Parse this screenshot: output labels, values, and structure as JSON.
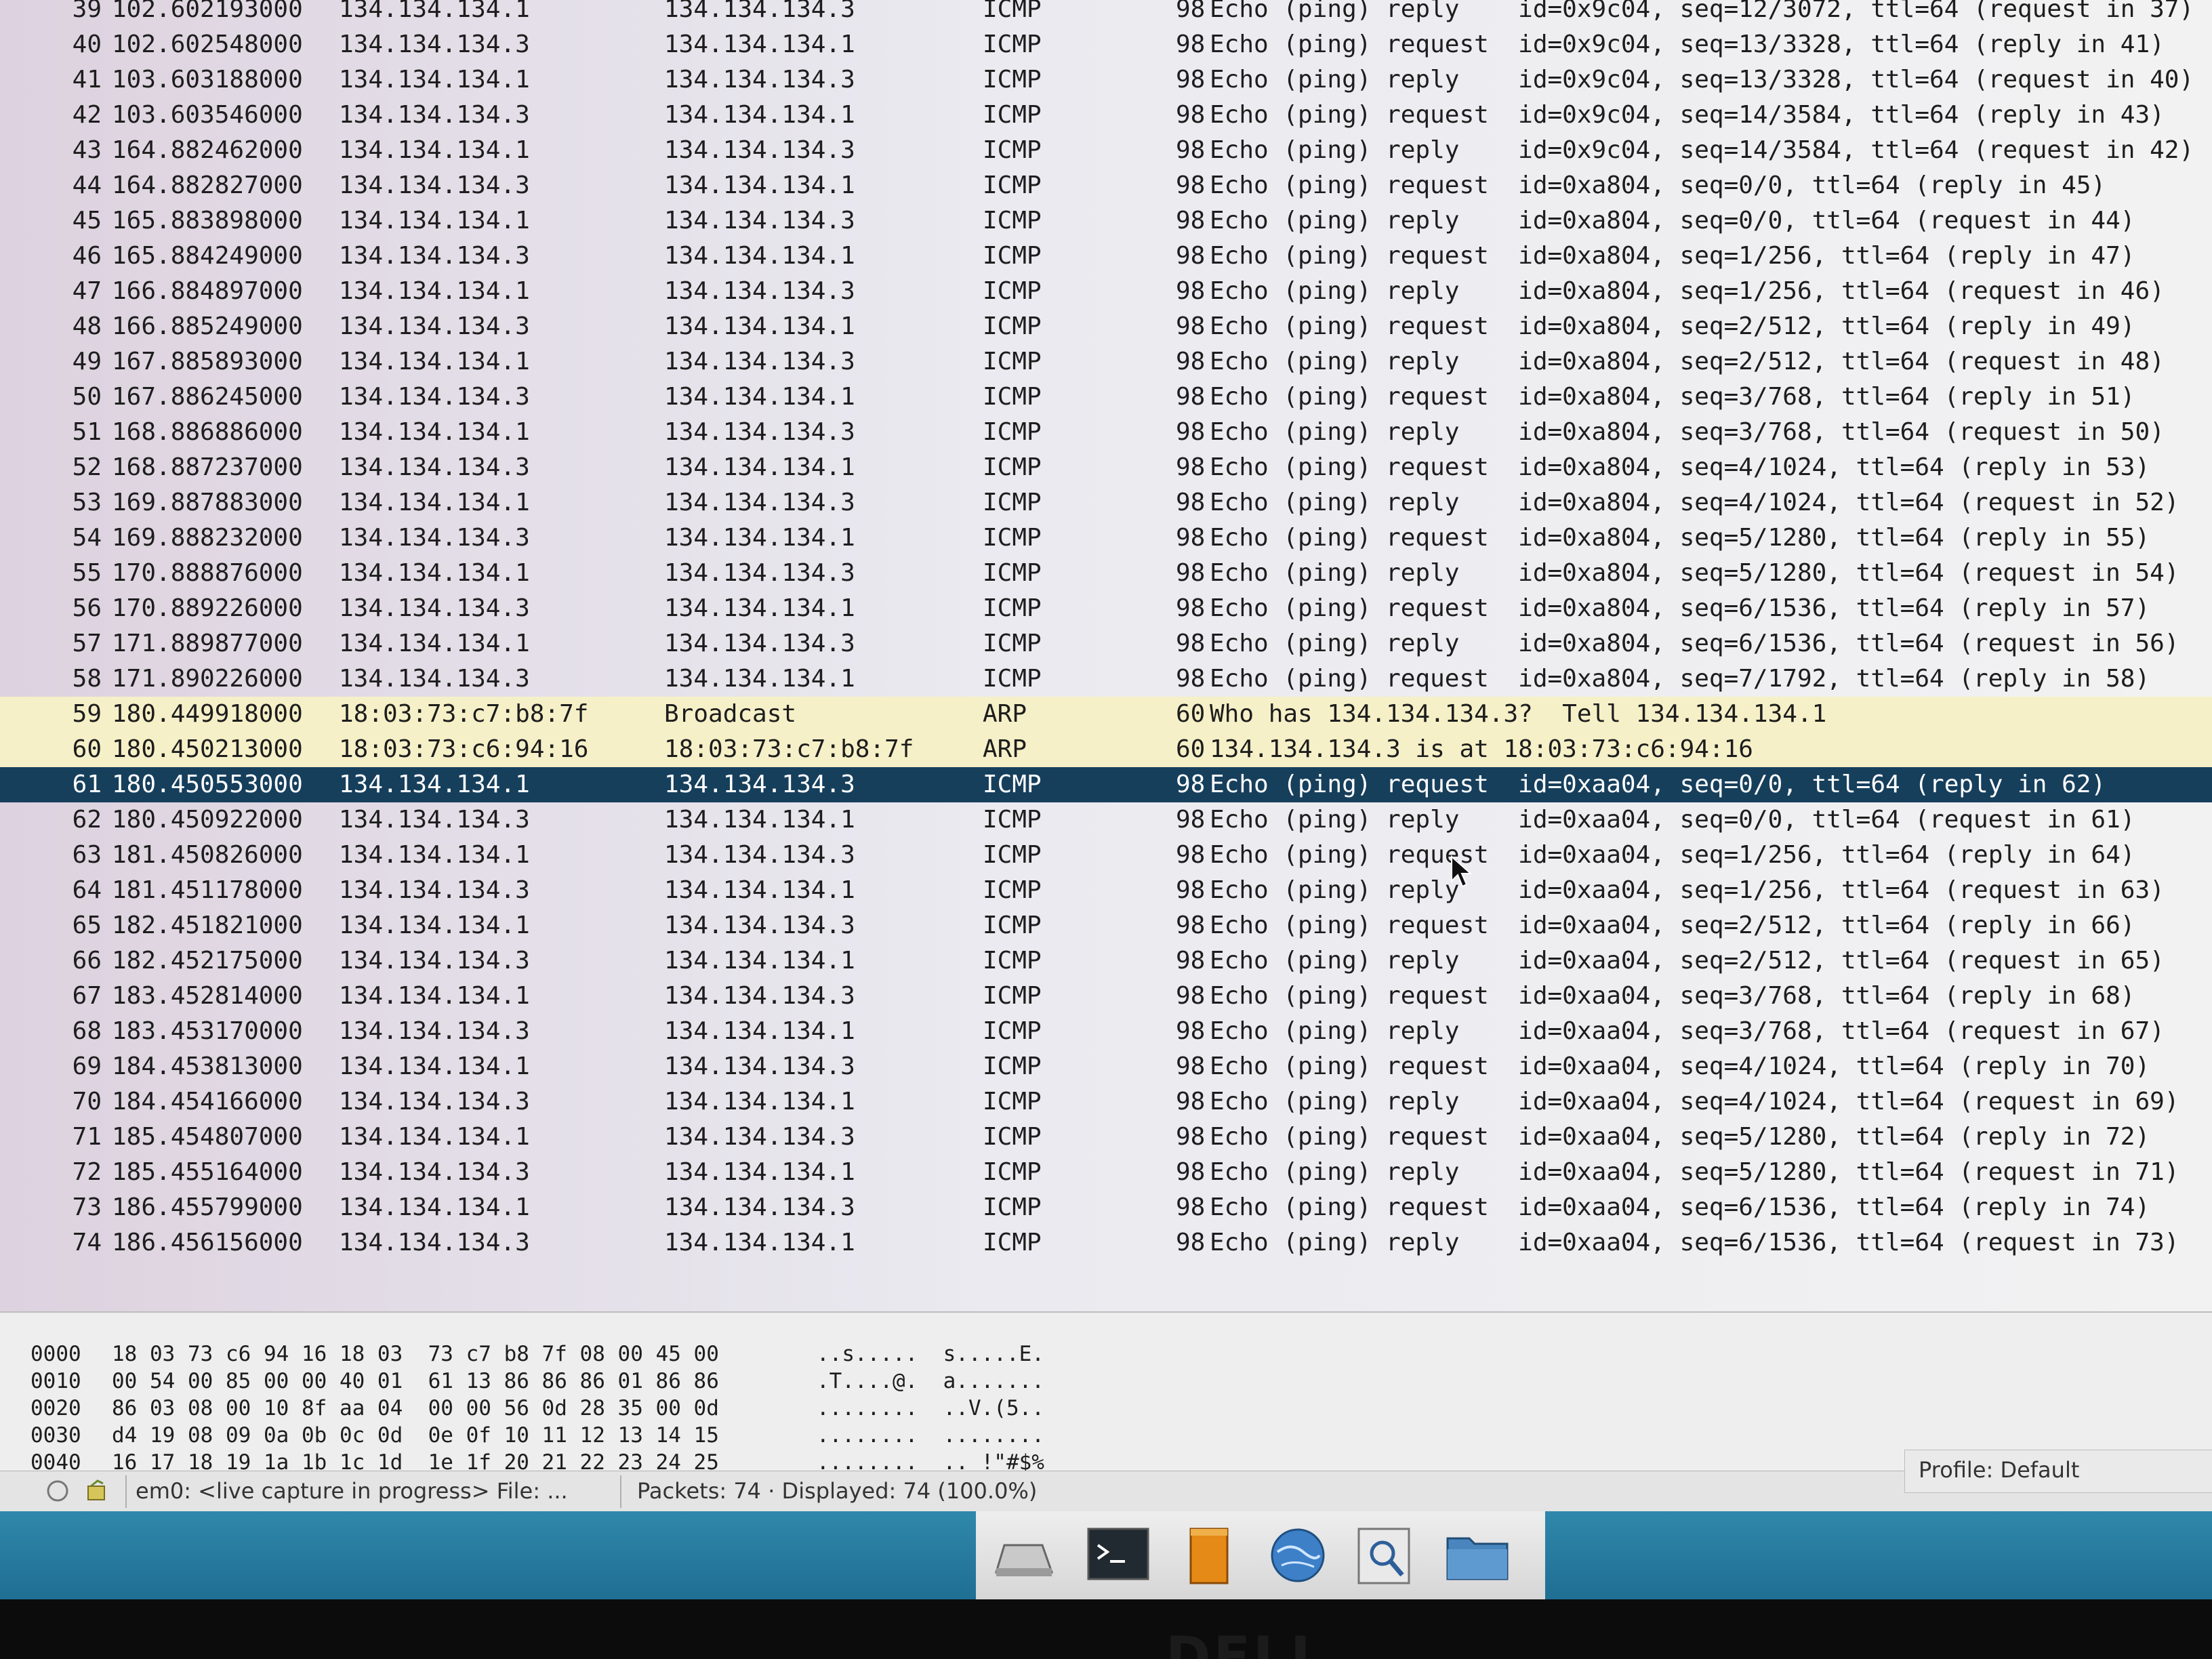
{
  "packets": [
    {
      "no": "39",
      "time": "102.602193000",
      "src": "134.134.134.1",
      "dst": "134.134.134.3",
      "proto": "ICMP",
      "len": "98",
      "info": "Echo (ping) reply    id=0x9c04, seq=12/3072, ttl=64 (request in 37)"
    },
    {
      "no": "40",
      "time": "102.602548000",
      "src": "134.134.134.3",
      "dst": "134.134.134.1",
      "proto": "ICMP",
      "len": "98",
      "info": "Echo (ping) request  id=0x9c04, seq=13/3328, ttl=64 (reply in 41)"
    },
    {
      "no": "41",
      "time": "103.603188000",
      "src": "134.134.134.1",
      "dst": "134.134.134.3",
      "proto": "ICMP",
      "len": "98",
      "info": "Echo (ping) reply    id=0x9c04, seq=13/3328, ttl=64 (request in 40)"
    },
    {
      "no": "42",
      "time": "103.603546000",
      "src": "134.134.134.3",
      "dst": "134.134.134.1",
      "proto": "ICMP",
      "len": "98",
      "info": "Echo (ping) request  id=0x9c04, seq=14/3584, ttl=64 (reply in 43)"
    },
    {
      "no": "43",
      "time": "164.882462000",
      "src": "134.134.134.1",
      "dst": "134.134.134.3",
      "proto": "ICMP",
      "len": "98",
      "info": "Echo (ping) reply    id=0x9c04, seq=14/3584, ttl=64 (request in 42)"
    },
    {
      "no": "44",
      "time": "164.882827000",
      "src": "134.134.134.3",
      "dst": "134.134.134.1",
      "proto": "ICMP",
      "len": "98",
      "info": "Echo (ping) request  id=0xa804, seq=0/0, ttl=64 (reply in 45)"
    },
    {
      "no": "45",
      "time": "165.883898000",
      "src": "134.134.134.1",
      "dst": "134.134.134.3",
      "proto": "ICMP",
      "len": "98",
      "info": "Echo (ping) reply    id=0xa804, seq=0/0, ttl=64 (request in 44)"
    },
    {
      "no": "46",
      "time": "165.884249000",
      "src": "134.134.134.3",
      "dst": "134.134.134.1",
      "proto": "ICMP",
      "len": "98",
      "info": "Echo (ping) request  id=0xa804, seq=1/256, ttl=64 (reply in 47)"
    },
    {
      "no": "47",
      "time": "166.884897000",
      "src": "134.134.134.1",
      "dst": "134.134.134.3",
      "proto": "ICMP",
      "len": "98",
      "info": "Echo (ping) reply    id=0xa804, seq=1/256, ttl=64 (request in 46)"
    },
    {
      "no": "48",
      "time": "166.885249000",
      "src": "134.134.134.3",
      "dst": "134.134.134.1",
      "proto": "ICMP",
      "len": "98",
      "info": "Echo (ping) request  id=0xa804, seq=2/512, ttl=64 (reply in 49)"
    },
    {
      "no": "49",
      "time": "167.885893000",
      "src": "134.134.134.1",
      "dst": "134.134.134.3",
      "proto": "ICMP",
      "len": "98",
      "info": "Echo (ping) reply    id=0xa804, seq=2/512, ttl=64 (request in 48)"
    },
    {
      "no": "50",
      "time": "167.886245000",
      "src": "134.134.134.3",
      "dst": "134.134.134.1",
      "proto": "ICMP",
      "len": "98",
      "info": "Echo (ping) request  id=0xa804, seq=3/768, ttl=64 (reply in 51)"
    },
    {
      "no": "51",
      "time": "168.886886000",
      "src": "134.134.134.1",
      "dst": "134.134.134.3",
      "proto": "ICMP",
      "len": "98",
      "info": "Echo (ping) reply    id=0xa804, seq=3/768, ttl=64 (request in 50)"
    },
    {
      "no": "52",
      "time": "168.887237000",
      "src": "134.134.134.3",
      "dst": "134.134.134.1",
      "proto": "ICMP",
      "len": "98",
      "info": "Echo (ping) request  id=0xa804, seq=4/1024, ttl=64 (reply in 53)"
    },
    {
      "no": "53",
      "time": "169.887883000",
      "src": "134.134.134.1",
      "dst": "134.134.134.3",
      "proto": "ICMP",
      "len": "98",
      "info": "Echo (ping) reply    id=0xa804, seq=4/1024, ttl=64 (request in 52)"
    },
    {
      "no": "54",
      "time": "169.888232000",
      "src": "134.134.134.3",
      "dst": "134.134.134.1",
      "proto": "ICMP",
      "len": "98",
      "info": "Echo (ping) request  id=0xa804, seq=5/1280, ttl=64 (reply in 55)"
    },
    {
      "no": "55",
      "time": "170.888876000",
      "src": "134.134.134.1",
      "dst": "134.134.134.3",
      "proto": "ICMP",
      "len": "98",
      "info": "Echo (ping) reply    id=0xa804, seq=5/1280, ttl=64 (request in 54)"
    },
    {
      "no": "56",
      "time": "170.889226000",
      "src": "134.134.134.3",
      "dst": "134.134.134.1",
      "proto": "ICMP",
      "len": "98",
      "info": "Echo (ping) request  id=0xa804, seq=6/1536, ttl=64 (reply in 57)"
    },
    {
      "no": "57",
      "time": "171.889877000",
      "src": "134.134.134.1",
      "dst": "134.134.134.3",
      "proto": "ICMP",
      "len": "98",
      "info": "Echo (ping) reply    id=0xa804, seq=6/1536, ttl=64 (request in 56)"
    },
    {
      "no": "58",
      "time": "171.890226000",
      "src": "134.134.134.3",
      "dst": "134.134.134.1",
      "proto": "ICMP",
      "len": "98",
      "info": "Echo (ping) request  id=0xa804, seq=7/1792, ttl=64 (reply in 58)"
    },
    {
      "no": "59",
      "time": "180.449918000",
      "src": "18:03:73:c7:b8:7f",
      "dst": "Broadcast",
      "proto": "ARP",
      "len": "60",
      "info": "Who has 134.134.134.3?  Tell 134.134.134.1"
    },
    {
      "no": "60",
      "time": "180.450213000",
      "src": "18:03:73:c6:94:16",
      "dst": "18:03:73:c7:b8:7f",
      "proto": "ARP",
      "len": "60",
      "info": "134.134.134.3 is at 18:03:73:c6:94:16"
    },
    {
      "no": "61",
      "time": "180.450553000",
      "src": "134.134.134.1",
      "dst": "134.134.134.3",
      "proto": "ICMP",
      "len": "98",
      "info": "Echo (ping) request  id=0xaa04, seq=0/0, ttl=64 (reply in 62)"
    },
    {
      "no": "62",
      "time": "180.450922000",
      "src": "134.134.134.3",
      "dst": "134.134.134.1",
      "proto": "ICMP",
      "len": "98",
      "info": "Echo (ping) reply    id=0xaa04, seq=0/0, ttl=64 (request in 61)"
    },
    {
      "no": "63",
      "time": "181.450826000",
      "src": "134.134.134.1",
      "dst": "134.134.134.3",
      "proto": "ICMP",
      "len": "98",
      "info": "Echo (ping) request  id=0xaa04, seq=1/256, ttl=64 (reply in 64)"
    },
    {
      "no": "64",
      "time": "181.451178000",
      "src": "134.134.134.3",
      "dst": "134.134.134.1",
      "proto": "ICMP",
      "len": "98",
      "info": "Echo (ping) reply    id=0xaa04, seq=1/256, ttl=64 (request in 63)"
    },
    {
      "no": "65",
      "time": "182.451821000",
      "src": "134.134.134.1",
      "dst": "134.134.134.3",
      "proto": "ICMP",
      "len": "98",
      "info": "Echo (ping) request  id=0xaa04, seq=2/512, ttl=64 (reply in 66)"
    },
    {
      "no": "66",
      "time": "182.452175000",
      "src": "134.134.134.3",
      "dst": "134.134.134.1",
      "proto": "ICMP",
      "len": "98",
      "info": "Echo (ping) reply    id=0xaa04, seq=2/512, ttl=64 (request in 65)"
    },
    {
      "no": "67",
      "time": "183.452814000",
      "src": "134.134.134.1",
      "dst": "134.134.134.3",
      "proto": "ICMP",
      "len": "98",
      "info": "Echo (ping) request  id=0xaa04, seq=3/768, ttl=64 (reply in 68)"
    },
    {
      "no": "68",
      "time": "183.453170000",
      "src": "134.134.134.3",
      "dst": "134.134.134.1",
      "proto": "ICMP",
      "len": "98",
      "info": "Echo (ping) reply    id=0xaa04, seq=3/768, ttl=64 (request in 67)"
    },
    {
      "no": "69",
      "time": "184.453813000",
      "src": "134.134.134.1",
      "dst": "134.134.134.3",
      "proto": "ICMP",
      "len": "98",
      "info": "Echo (ping) request  id=0xaa04, seq=4/1024, ttl=64 (reply in 70)"
    },
    {
      "no": "70",
      "time": "184.454166000",
      "src": "134.134.134.3",
      "dst": "134.134.134.1",
      "proto": "ICMP",
      "len": "98",
      "info": "Echo (ping) reply    id=0xaa04, seq=4/1024, ttl=64 (request in 69)"
    },
    {
      "no": "71",
      "time": "185.454807000",
      "src": "134.134.134.1",
      "dst": "134.134.134.3",
      "proto": "ICMP",
      "len": "98",
      "info": "Echo (ping) request  id=0xaa04, seq=5/1280, ttl=64 (reply in 72)"
    },
    {
      "no": "72",
      "time": "185.455164000",
      "src": "134.134.134.3",
      "dst": "134.134.134.1",
      "proto": "ICMP",
      "len": "98",
      "info": "Echo (ping) reply    id=0xaa04, seq=5/1280, ttl=64 (request in 71)"
    },
    {
      "no": "73",
      "time": "186.455799000",
      "src": "134.134.134.1",
      "dst": "134.134.134.3",
      "proto": "ICMP",
      "len": "98",
      "info": "Echo (ping) request  id=0xaa04, seq=6/1536, ttl=64 (reply in 74)"
    },
    {
      "no": "74",
      "time": "186.456156000",
      "src": "134.134.134.3",
      "dst": "134.134.134.1",
      "proto": "ICMP",
      "len": "98",
      "info": "Echo (ping) reply    id=0xaa04, seq=6/1536, ttl=64 (request in 73)"
    }
  ],
  "selected_packet": "61",
  "bytes": [
    {
      "offset": "0000",
      "hex": "18 03 73 c6 94 16 18 03  73 c7 b8 7f 08 00 45 00",
      "ascii": "..s.....  s.....E."
    },
    {
      "offset": "0010",
      "hex": "00 54 00 85 00 00 40 01  61 13 86 86 86 01 86 86",
      "ascii": ".T....@.  a......."
    },
    {
      "offset": "0020",
      "hex": "86 03 08 00 10 8f aa 04  00 00 56 0d 28 35 00 0d",
      "ascii": "........  ..V.(5.."
    },
    {
      "offset": "0030",
      "hex": "d4 19 08 09 0a 0b 0c 0d  0e 0f 10 11 12 13 14 15",
      "ascii": "........  ........"
    },
    {
      "offset": "0040",
      "hex": "16 17 18 19 1a 1b 1c 1d  1e 1f 20 21 22 23 24 25",
      "ascii": "........  .. !\"#$%"
    }
  ],
  "status": {
    "capture": "em0: <live capture in progress> File: ...",
    "packets": "Packets: 74 · Displayed: 74 (100.0%)",
    "profile": "Profile: Default"
  },
  "colors": {
    "selected_row": "#163f5c",
    "arp_row": "#f6f0c8",
    "taskbar": "#2a7fa3"
  },
  "dock_icons": [
    "drive-icon",
    "terminal-icon",
    "notes-icon",
    "globe-icon",
    "search-icon",
    "folder-icon"
  ]
}
